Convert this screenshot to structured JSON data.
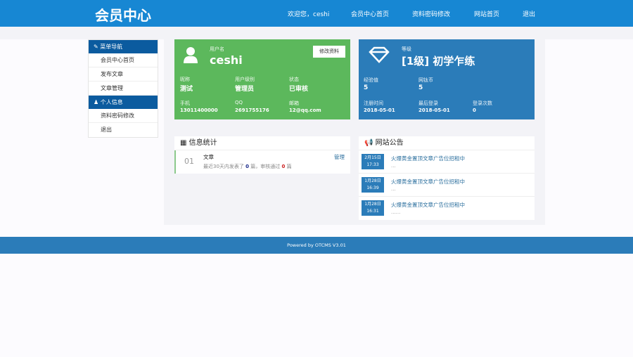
{
  "header": {
    "logo": "会员中心",
    "nav": [
      "欢迎您，ceshi",
      "会员中心首页",
      "资料密码修改",
      "网站首页",
      "退出"
    ]
  },
  "sidebar": {
    "sections": [
      {
        "title": "菜单导航",
        "items": [
          "会员中心首页",
          "发布文章",
          "文章管理"
        ]
      },
      {
        "title": "个人信息",
        "items": [
          "资料密码修改",
          "退出"
        ]
      }
    ]
  },
  "user_card": {
    "username_label": "用户名",
    "username": "ceshi",
    "edit_button": "修改资料",
    "fields": [
      {
        "label": "昵称",
        "value": "测试"
      },
      {
        "label": "用户级别",
        "value": "管理员"
      },
      {
        "label": "状态",
        "value": "已审核"
      },
      {
        "label": "手机",
        "value": "13011400000"
      },
      {
        "label": "QQ",
        "value": "2691755176"
      },
      {
        "label": "邮箱",
        "value": "12@qq.com"
      }
    ],
    "color": "#5cb85c"
  },
  "level_card": {
    "level_label": "等级",
    "level": "[1级] 初学乍练",
    "fields": [
      {
        "label": "经验值",
        "value": "5"
      },
      {
        "label": "网钛币",
        "value": "5"
      },
      {
        "label": "注册时间",
        "value": "2018-05-01"
      },
      {
        "label": "最后登录",
        "value": "2018-05-01"
      },
      {
        "label": "登录次数",
        "value": "0"
      }
    ],
    "color": "#2b7cb9"
  },
  "stats": {
    "title": "信息统计",
    "items": [
      {
        "num": "01",
        "name": "文章",
        "manage": "管理",
        "desc_prefix": "最近30天内发表了",
        "published": "0",
        "mid": "篇，审核通过",
        "approved": "0",
        "suffix": "篇"
      }
    ]
  },
  "notices": {
    "title": "网站公告",
    "items": [
      {
        "date": "2月15日",
        "time": "17:33",
        "title": "火爆黄金置顶文章广告位招租中",
        "sub": "..."
      },
      {
        "date": "1月28日",
        "time": "16:39",
        "title": "火爆黄金置顶文章广告位招租中",
        "sub": "..."
      },
      {
        "date": "1月28日",
        "time": "16:31",
        "title": "火爆黄金置顶文章广告位招租中",
        "sub": "......"
      }
    ]
  },
  "footer": {
    "text": "Powered by OTCMS V3.01"
  }
}
